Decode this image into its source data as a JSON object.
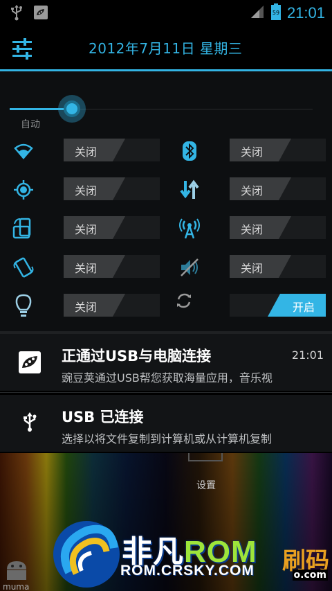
{
  "status_bar": {
    "time": "21:01",
    "icons": [
      "usb-icon",
      "wandoujia-icon",
      "signal-icon",
      "battery-icon"
    ]
  },
  "header": {
    "date": "2012年7月11日 星期三",
    "settings_icon": "settings-sliders-icon"
  },
  "brightness": {
    "auto_label": "自动",
    "level": 0.2
  },
  "quick_settings": {
    "left": [
      {
        "icon": "wifi-icon",
        "label": "关闭",
        "on": false
      },
      {
        "icon": "gps-icon",
        "label": "关闭",
        "on": false
      },
      {
        "icon": "rotation-icon",
        "label": "关闭",
        "on": false
      },
      {
        "icon": "vibrate-icon",
        "label": "关闭",
        "on": false
      },
      {
        "icon": "flashlight-icon",
        "label": "关闭",
        "on": false
      }
    ],
    "right": [
      {
        "icon": "bluetooth-icon",
        "label": "关闭",
        "on": false
      },
      {
        "icon": "data-transfer-icon",
        "label": "关闭",
        "on": false
      },
      {
        "icon": "hotspot-icon",
        "label": "关闭",
        "on": false
      },
      {
        "icon": "sound-mute-icon",
        "label": "关闭",
        "on": false
      },
      {
        "icon": "sync-icon",
        "label": "开启",
        "on": true
      }
    ]
  },
  "notifications": [
    {
      "icon": "wandoujia-icon",
      "title": "正通过USB与电脑连接",
      "text": "豌豆荚通过USB帮您获取海量应用，音乐视",
      "time": "21:01"
    },
    {
      "icon": "usb-icon",
      "title": "USB 已连接",
      "text": "选择以将文件复制到计算机或从计算机复制",
      "time": ""
    }
  ],
  "wallpaper": {
    "settings_label": "设置",
    "small_text": "muma"
  },
  "watermark": {
    "brand_cn": "非凡",
    "brand_en": "ROM",
    "url": "ROM.CRSKY.COM",
    "corner": "刷码",
    "corner_small": "o.com"
  },
  "colors": {
    "accent": "#33b5e5",
    "toggle_off": "#3a3c3e",
    "background": "#0d0f11"
  }
}
